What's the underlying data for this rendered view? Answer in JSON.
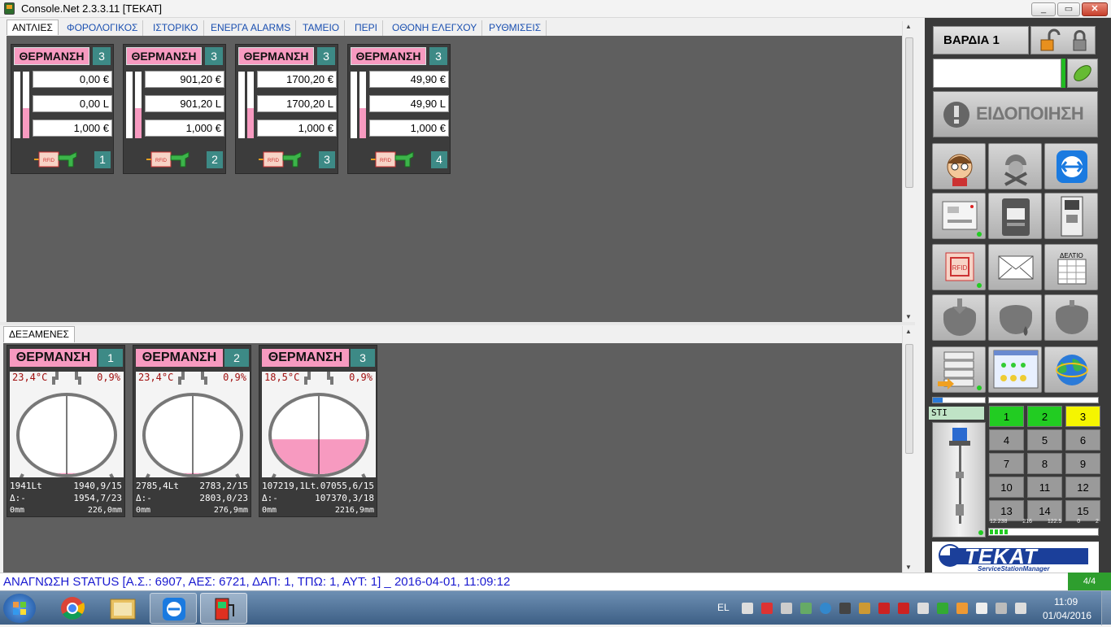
{
  "window": {
    "title": "Console.Net 2.3.3.11 [TEKAT]",
    "min": "_",
    "max": "▭",
    "close": "✕"
  },
  "tabs": [
    {
      "label": "ΑΝΤΛΙΕΣ",
      "active": true
    },
    {
      "label": "ΦΟΡΟΛΟΓΙΚΟΣ"
    },
    {
      "label": "ΙΣΤΟΡΙΚΟ"
    },
    {
      "label": "ΕΝΕΡΓΑ ALARMS"
    },
    {
      "label": "ΤΑΜΕΙΟ"
    },
    {
      "label": "ΠΕΡΙ"
    },
    {
      "label": "ΟΘΟΝΗ ΕΛΕΓΧΟΥ"
    },
    {
      "label": "ΡΥΘΜΙΣΕΙΣ"
    }
  ],
  "pumps": [
    {
      "product": "ΘΕΡΜΑΝΣΗ",
      "grade": "3",
      "amount": "0,00 €",
      "volume": "0,00 L",
      "price": "1,000 €",
      "number": "1",
      "rfid": "RFID",
      "levels": [
        0.0,
        0.45
      ]
    },
    {
      "product": "ΘΕΡΜΑΝΣΗ",
      "grade": "3",
      "amount": "901,20 €",
      "volume": "901,20 L",
      "price": "1,000 €",
      "number": "2",
      "rfid": "RFID",
      "levels": [
        0.0,
        0.45
      ]
    },
    {
      "product": "ΘΕΡΜΑΝΣΗ",
      "grade": "3",
      "amount": "1700,20 €",
      "volume": "1700,20 L",
      "price": "1,000 €",
      "number": "3",
      "rfid": "RFID",
      "levels": [
        0.0,
        0.45
      ]
    },
    {
      "product": "ΘΕΡΜΑΝΣΗ",
      "grade": "3",
      "amount": "49,90 €",
      "volume": "49,90 L",
      "price": "1,000 €",
      "number": "4",
      "rfid": "RFID",
      "levels": [
        0.0,
        0.45
      ]
    }
  ],
  "tanks_tab": "ΔΕΞΑΜΕΝΕΣ",
  "tanks": [
    {
      "product": "ΘΕΡΜΑΝΣΗ",
      "number": "1",
      "temp": "23,4°C",
      "pct": "0,9%",
      "fill": 0.05,
      "l1": "1941Lt",
      "l1r": "1940,9/15",
      "l2": "Δ:-",
      "l2r": "1954,7/23",
      "l3": "0mm",
      "l3r": "226,0mm"
    },
    {
      "product": "ΘΕΡΜΑΝΣΗ",
      "number": "2",
      "temp": "23,4°C",
      "pct": "0,9%",
      "fill": 0.05,
      "l1": "2785,4Lt",
      "l1r": "2783,2/15",
      "l2": "Δ:-",
      "l2r": "2803,0/23",
      "l3": "0mm",
      "l3r": "276,9mm"
    },
    {
      "product": "ΘΕΡΜΑΝΣΗ",
      "number": "3",
      "temp": "18,5°C",
      "pct": "0,9%",
      "fill": 0.45,
      "l1": "107219,1Lt",
      "l1r": ".07055,6/15",
      "l2": "Δ:-",
      "l2r": "107370,3/18",
      "l3": "0mm",
      "l3r": "2216,9mm"
    }
  ],
  "status": {
    "text": "ΑΝΑΓΝΩΣΗ STATUS [Α.Σ.: 6907, ΑΕΣ: 6721, ΔΑΠ: 1, ΤΠΩ: 1, ΑΥΤ: 1] _ 2016-04-01, 11:09:12",
    "page": "4/4"
  },
  "right": {
    "shift": "ΒΑΡΔΙΑ 1",
    "notify": "ΕΙΔΟΠΟΙΗΣΗ",
    "deltio": "ΔΕΛΤΙΟ",
    "sti": "STI",
    "pump_buttons": [
      "1",
      "2",
      "3",
      "4",
      "5",
      "6",
      "7",
      "8",
      "9",
      "10",
      "11",
      "12",
      "13",
      "14",
      "15"
    ],
    "mini_readout": [
      "12.238",
      "216",
      "122.5",
      "0",
      "2"
    ],
    "brand": "TEKAT",
    "brand_sub": "ServiceStationManager"
  },
  "taskbar": {
    "lang": "EL",
    "time": "11:09",
    "date": "01/04/2016"
  }
}
